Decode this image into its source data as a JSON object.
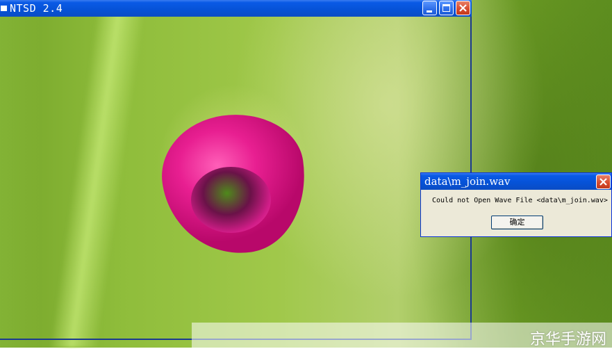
{
  "main_window": {
    "title": "NTSD 2.4",
    "controls": {
      "minimize": "minimize",
      "maximize": "maximize",
      "close": "close"
    }
  },
  "dialog": {
    "title": "data\\m_join.wav",
    "message": "Could not Open Wave File <data\\m_join.wav>",
    "ok_label": "确定"
  },
  "watermark": {
    "text": "京华手游网"
  },
  "colors": {
    "titlebar": "#0652d6",
    "close_button": "#d6492b",
    "dialog_bg": "#ece9d8",
    "bud_pink": "#e81f91",
    "wallpaper_green": "#8fbd3b"
  }
}
